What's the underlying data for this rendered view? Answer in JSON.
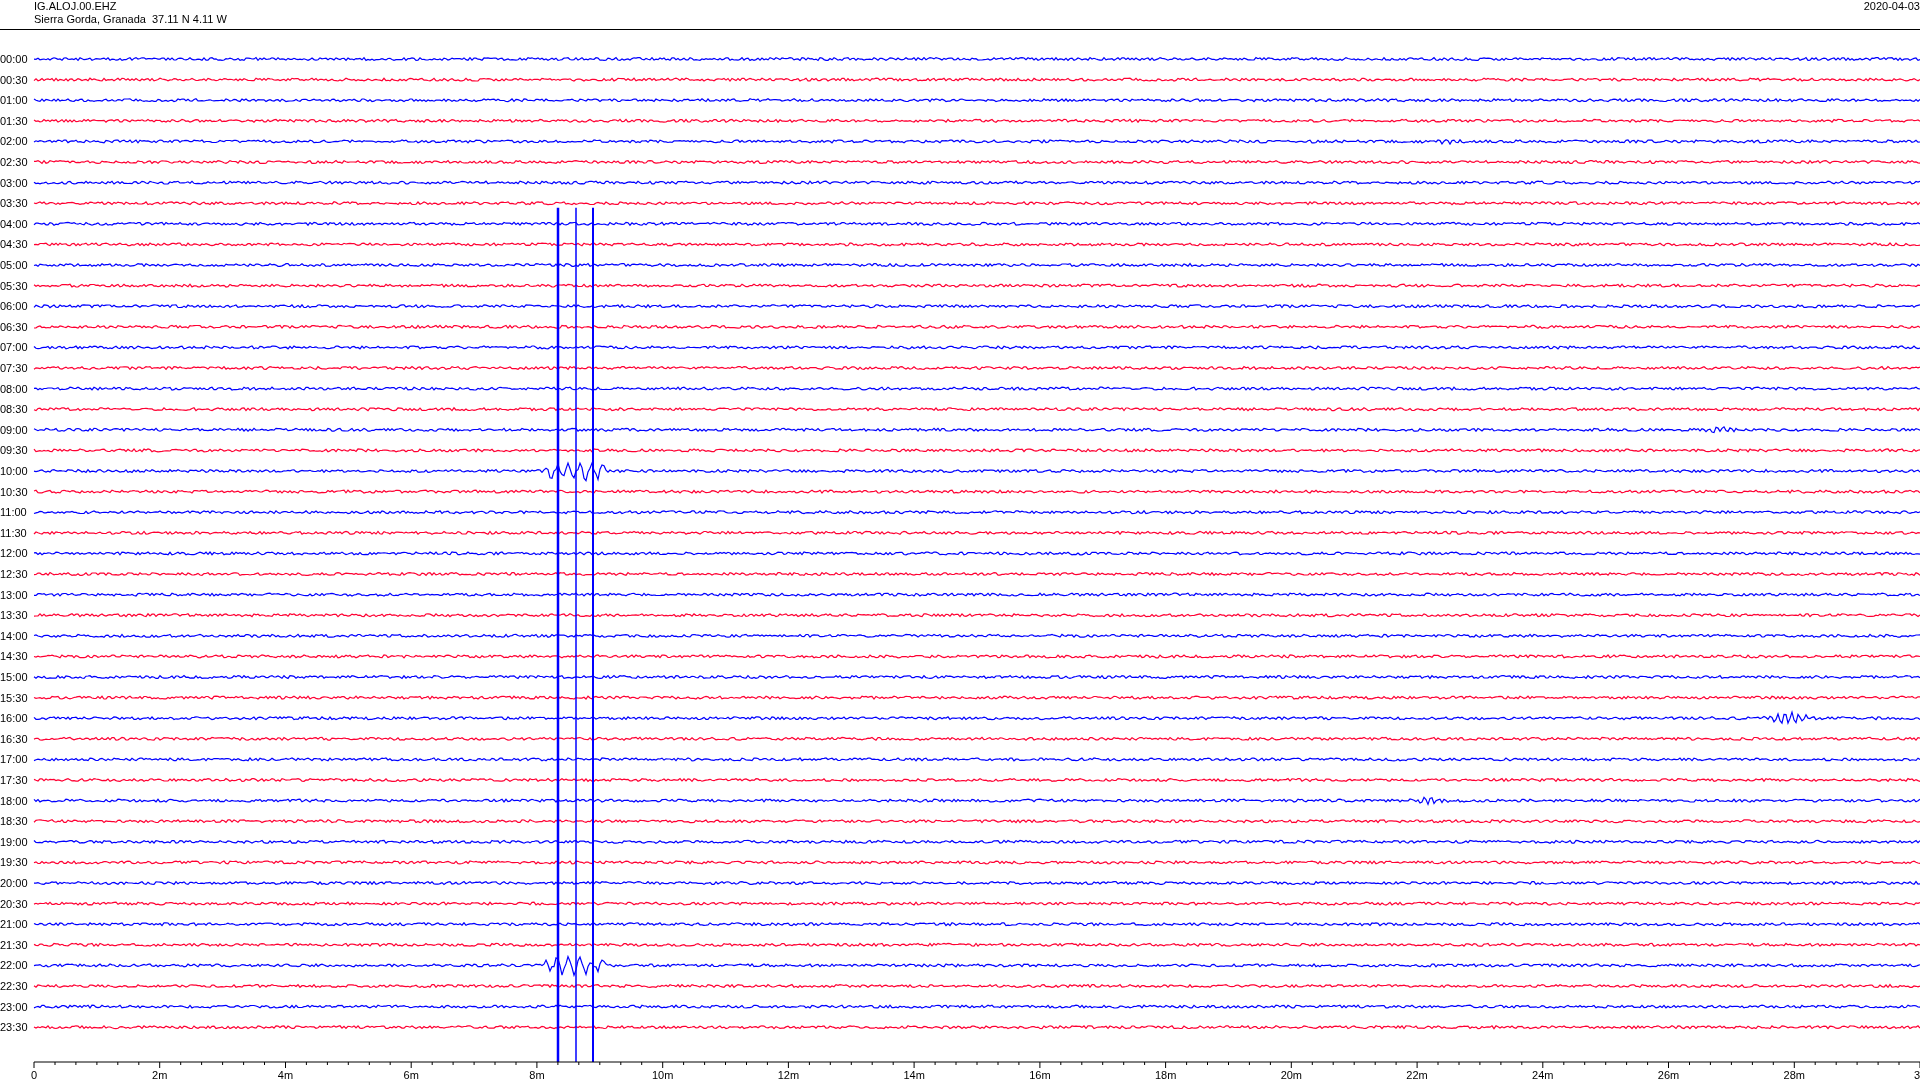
{
  "header": {
    "station": "IG.ALOJ.00.EHZ",
    "location": "Sierra Gorda, Granada  37.11 N 4.11 W",
    "date": "2020-04-03"
  },
  "rows": [
    {
      "time": "00:00",
      "color": "#0000ff"
    },
    {
      "time": "00:30",
      "color": "#ff0033"
    },
    {
      "time": "01:00",
      "color": "#0000ff"
    },
    {
      "time": "01:30",
      "color": "#ff0033"
    },
    {
      "time": "02:00",
      "color": "#0000ff"
    },
    {
      "time": "02:30",
      "color": "#ff0033"
    },
    {
      "time": "03:00",
      "color": "#0000ff"
    },
    {
      "time": "03:30",
      "color": "#ff0033"
    },
    {
      "time": "04:00",
      "color": "#0000ff"
    },
    {
      "time": "04:30",
      "color": "#ff0033"
    },
    {
      "time": "05:00",
      "color": "#0000ff"
    },
    {
      "time": "05:30",
      "color": "#ff0033"
    },
    {
      "time": "06:00",
      "color": "#0000ff"
    },
    {
      "time": "06:30",
      "color": "#ff0033"
    },
    {
      "time": "07:00",
      "color": "#0000ff"
    },
    {
      "time": "07:30",
      "color": "#ff0033"
    },
    {
      "time": "08:00",
      "color": "#0000ff"
    },
    {
      "time": "08:30",
      "color": "#ff0033"
    },
    {
      "time": "09:00",
      "color": "#0000ff"
    },
    {
      "time": "09:30",
      "color": "#ff0033"
    },
    {
      "time": "10:00",
      "color": "#0000ff"
    },
    {
      "time": "10:30",
      "color": "#ff0033"
    },
    {
      "time": "11:00",
      "color": "#0000ff"
    },
    {
      "time": "11:30",
      "color": "#ff0033"
    },
    {
      "time": "12:00",
      "color": "#0000ff"
    },
    {
      "time": "12:30",
      "color": "#ff0033"
    },
    {
      "time": "13:00",
      "color": "#0000ff"
    },
    {
      "time": "13:30",
      "color": "#ff0033"
    },
    {
      "time": "14:00",
      "color": "#0000ff"
    },
    {
      "time": "14:30",
      "color": "#ff0033"
    },
    {
      "time": "15:00",
      "color": "#0000ff"
    },
    {
      "time": "15:30",
      "color": "#ff0033"
    },
    {
      "time": "16:00",
      "color": "#0000ff"
    },
    {
      "time": "16:30",
      "color": "#ff0033"
    },
    {
      "time": "17:00",
      "color": "#0000ff"
    },
    {
      "time": "17:30",
      "color": "#ff0033"
    },
    {
      "time": "18:00",
      "color": "#0000ff"
    },
    {
      "time": "18:30",
      "color": "#ff0033"
    },
    {
      "time": "19:00",
      "color": "#0000ff"
    },
    {
      "time": "19:30",
      "color": "#ff0033"
    },
    {
      "time": "20:00",
      "color": "#0000ff"
    },
    {
      "time": "20:30",
      "color": "#ff0033"
    },
    {
      "time": "21:00",
      "color": "#0000ff"
    },
    {
      "time": "21:30",
      "color": "#ff0033"
    },
    {
      "time": "22:00",
      "color": "#0000ff"
    },
    {
      "time": "22:30",
      "color": "#ff0033"
    },
    {
      "time": "23:00",
      "color": "#0000ff"
    },
    {
      "time": "23:30",
      "color": "#ff0033"
    }
  ],
  "axis": {
    "ticks": [
      "0",
      "2m",
      "4m",
      "6m",
      "8m",
      "10m",
      "12m",
      "14m",
      "16m",
      "18m",
      "20m",
      "22m",
      "24m",
      "26m",
      "28m",
      "3"
    ]
  }
}
